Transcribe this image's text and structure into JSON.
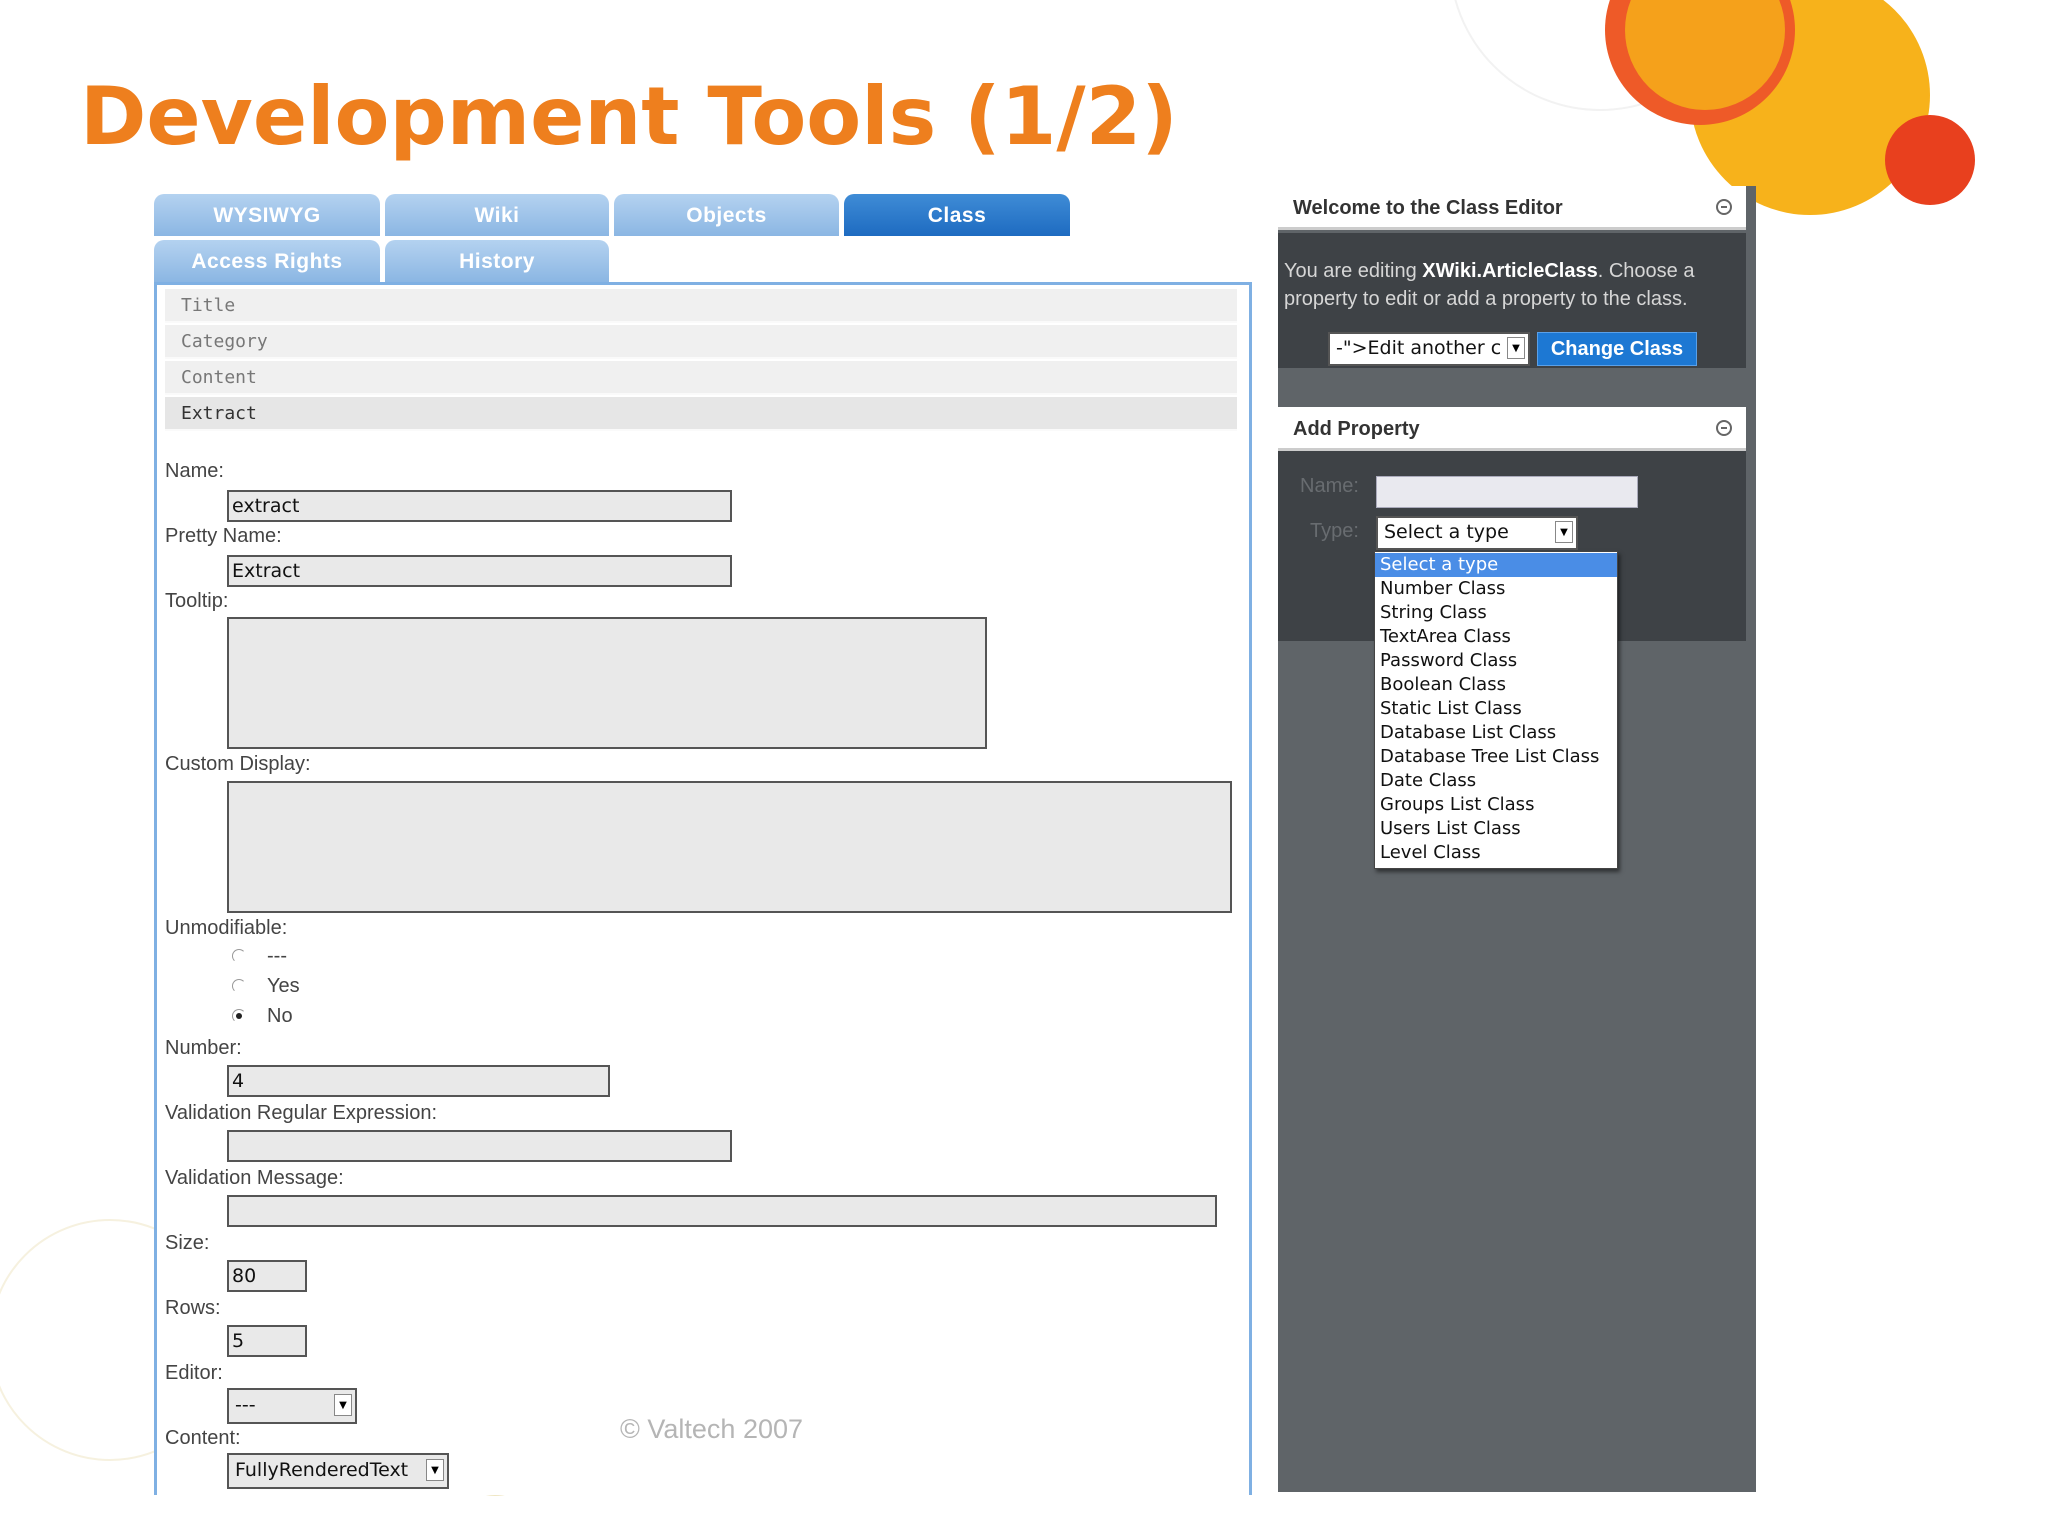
{
  "slide": {
    "title": "Development Tools (1/2)",
    "copyright": "© Valtech 2007"
  },
  "tabs": [
    {
      "label": "WYSIWYG"
    },
    {
      "label": "Wiki"
    },
    {
      "label": "Objects"
    },
    {
      "label": "Class",
      "active": true
    },
    {
      "label": "Access Rights"
    },
    {
      "label": "History"
    }
  ],
  "properties": [
    "Title",
    "Category",
    "Content",
    "Extract"
  ],
  "form": {
    "name_label": "Name:",
    "name_value": "extract",
    "pretty_name_label": "Pretty Name:",
    "pretty_name_value": "Extract",
    "tooltip_label": "Tooltip:",
    "custom_display_label": "Custom Display:",
    "unmodifiable_label": "Unmodifiable:",
    "unmodifiable_options": [
      "---",
      "Yes",
      "No"
    ],
    "unmodifiable_selected": "No",
    "number_label": "Number:",
    "number_value": "4",
    "validation_regex_label": "Validation Regular Expression:",
    "validation_message_label": "Validation Message:",
    "size_label": "Size:",
    "size_value": "80",
    "rows_label": "Rows:",
    "rows_value": "5",
    "editor_label": "Editor:",
    "editor_value": "---",
    "content_label": "Content:",
    "content_value": "FullyRenderedText"
  },
  "class_editor": {
    "title": "Welcome to the Class Editor",
    "text_before": "You are editing ",
    "class_name": "XWiki.ArticleClass",
    "text_after": ". Choose a property to edit or add a property to the class.",
    "select_value": "-\">Edit another c",
    "change_button": "Change Class"
  },
  "add_property": {
    "title": "Add Property",
    "name_label": "Name:",
    "type_label": "Type:",
    "type_value": "Select a type",
    "type_options": [
      "Select a type",
      "Number Class",
      "String Class",
      "TextArea Class",
      "Password Class",
      "Boolean Class",
      "Static List Class",
      "Database List Class",
      "Database Tree List Class",
      "Date Class",
      "Groups List Class",
      "Users List Class",
      "Level Class"
    ]
  },
  "colors": {
    "title_orange": "#ee7f1e",
    "tab_light": "#8bb6e3",
    "tab_active": "#1e6bc1",
    "sidebar_bg": "#5f6468",
    "button_blue": "#1d78d3"
  }
}
